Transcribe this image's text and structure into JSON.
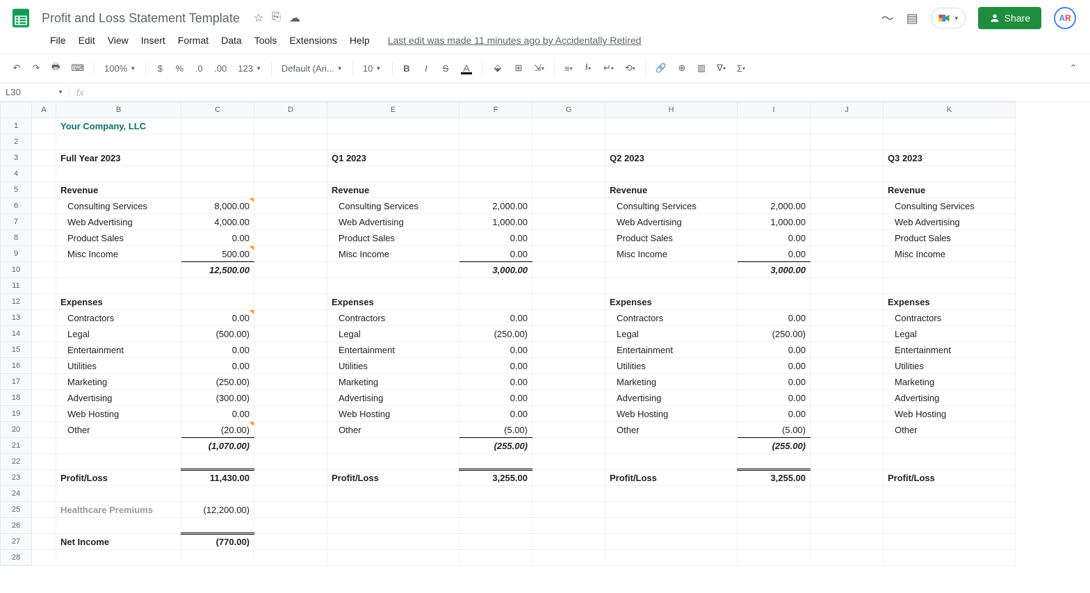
{
  "doc": {
    "title": "Profit and Loss Statement Template"
  },
  "menu": {
    "file": "File",
    "edit": "Edit",
    "view": "View",
    "insert": "Insert",
    "format": "Format",
    "data": "Data",
    "tools": "Tools",
    "extensions": "Extensions",
    "help": "Help",
    "last_edit": "Last edit was made 11 minutes ago by Accidentally Retired"
  },
  "toolbar": {
    "zoom": "100%",
    "font": "Default (Ari...",
    "size": "10",
    "fmt123": "123"
  },
  "share": "Share",
  "namebox": "L30",
  "cols": [
    "A",
    "B",
    "C",
    "D",
    "E",
    "F",
    "G",
    "H",
    "I",
    "J",
    "K"
  ],
  "labels": {
    "company": "Your Company, LLC",
    "fullyear": "Full Year 2023",
    "q1": "Q1 2023",
    "q2": "Q2 2023",
    "q3": "Q3 2023",
    "revenue": "Revenue",
    "expenses": "Expenses",
    "pl": "Profit/Loss",
    "hc": "Healthcare Premiums",
    "ni": "Net Income",
    "consulting": "Consulting Services",
    "web": "Web Advertising",
    "product": "Product Sales",
    "misc": "Misc Income",
    "contractors": "Contractors",
    "legal": "Legal",
    "entertainment": "Entertainment",
    "utilities": "Utilities",
    "marketing": "Marketing",
    "advertising": "Advertising",
    "hosting": "Web Hosting",
    "other": "Other"
  },
  "vals": {
    "fy": {
      "consulting": "8,000.00",
      "web": "4,000.00",
      "product": "0.00",
      "misc": "500.00",
      "rev_total": "12,500.00",
      "contractors": "0.00",
      "legal": "(500.00)",
      "entertainment": "0.00",
      "utilities": "0.00",
      "marketing": "(250.00)",
      "advertising": "(300.00)",
      "hosting": "0.00",
      "other": "(20.00)",
      "exp_total": "(1,070.00)",
      "pl": "11,430.00",
      "hc": "(12,200.00)",
      "ni": "(770.00)"
    },
    "q1": {
      "consulting": "2,000.00",
      "web": "1,000.00",
      "product": "0.00",
      "misc": "0.00",
      "rev_total": "3,000.00",
      "contractors": "0.00",
      "legal": "(250.00)",
      "entertainment": "0.00",
      "utilities": "0.00",
      "marketing": "0.00",
      "advertising": "0.00",
      "hosting": "0.00",
      "other": "(5.00)",
      "exp_total": "(255.00)",
      "pl": "3,255.00"
    },
    "q2": {
      "consulting": "2,000.00",
      "web": "1,000.00",
      "product": "0.00",
      "misc": "0.00",
      "rev_total": "3,000.00",
      "contractors": "0.00",
      "legal": "(250.00)",
      "entertainment": "0.00",
      "utilities": "0.00",
      "marketing": "0.00",
      "advertising": "0.00",
      "hosting": "0.00",
      "other": "(5.00)",
      "exp_total": "(255.00)",
      "pl": "3,255.00"
    }
  }
}
